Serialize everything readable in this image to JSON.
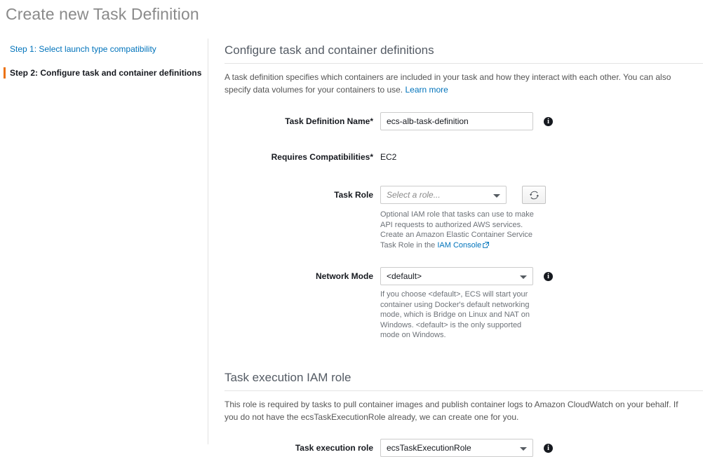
{
  "page": {
    "title": "Create new Task Definition"
  },
  "steps": [
    {
      "label": "Step 1: Select launch type compatibility",
      "state": "completed-link"
    },
    {
      "label": "Step 2: Configure task and container definitions",
      "state": "current"
    }
  ],
  "sections": [
    {
      "id": "configure",
      "title": "Configure task and container definitions",
      "description_before_link": "A task definition specifies which containers are included in your task and how they interact with each other. You can also specify data volumes for your containers to use. ",
      "description_link": "Learn more"
    },
    {
      "id": "exec_role",
      "title": "Task execution IAM role",
      "description": "This role is required by tasks to pull container images and publish container logs to Amazon CloudWatch on your behalf. If you do not have the ecsTaskExecutionRole already, we can create one for you."
    }
  ],
  "fields": {
    "task_definition_name": {
      "label": "Task Definition Name*",
      "value": "ecs-alb-task-definition",
      "placeholder": "",
      "info_icon": "info-icon"
    },
    "requires_compatibilities": {
      "label": "Requires Compatibilities*",
      "value": "EC2"
    },
    "task_role": {
      "label": "Task Role",
      "value": "Select a role...",
      "is_placeholder": true,
      "refresh_icon": "refresh-icon",
      "help_text_part1": "Optional IAM role that tasks can use to make API requests to authorized AWS services. Create an Amazon Elastic Container Service Task Role in the ",
      "help_link": "IAM Console",
      "external_icon": "external-link-icon"
    },
    "network_mode": {
      "label": "Network Mode",
      "value": "<default>",
      "info_icon": "info-icon",
      "help_text": "If you choose <default>, ECS will start your container using Docker's default networking mode, which is Bridge on Linux and NAT on Windows. <default> is the only supported mode on Windows."
    },
    "task_execution_role": {
      "label": "Task execution role",
      "value": "ecsTaskExecutionRole",
      "info_icon": "info-icon"
    }
  },
  "colors": {
    "accent_orange": "#ec7211",
    "link_blue": "#0073bb",
    "title_gray": "#8a8a8a",
    "section_gray": "#545b64",
    "text_dark": "#16191f",
    "border_gray": "#cccccc"
  }
}
